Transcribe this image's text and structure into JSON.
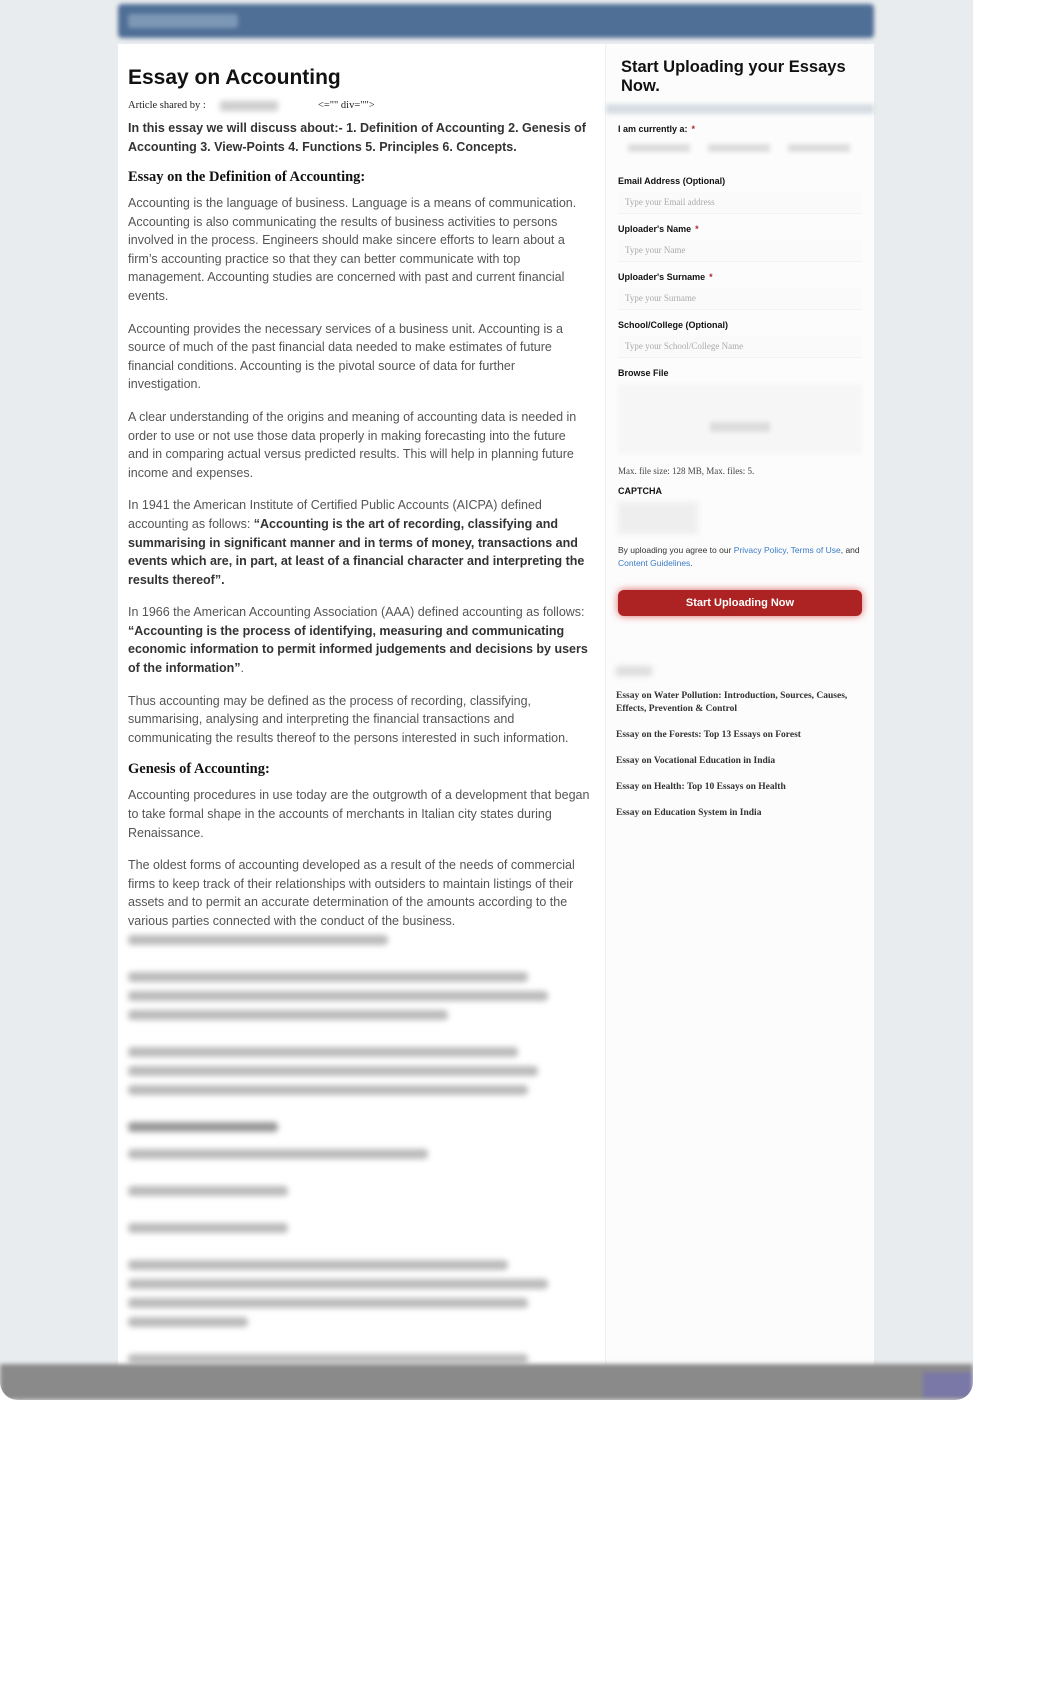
{
  "article": {
    "title": "Essay on Accounting",
    "byline_label": "Article shared by :",
    "byline_artifact": "<=\"\" div=\"\">",
    "intro": "In this essay we will discuss about:- 1. Definition of Accounting 2. Genesis of Accounting 3. View-Points 4. Functions 5. Principles 6. Concepts.",
    "section1_heading": "Essay on the Definition of Accounting:",
    "p1": "Accounting is the language of business. Language is a means of communication. Accounting is also communicating the results of business activities to persons involved in the process. Engineers should make sincere efforts to learn about a firm’s accounting practice so that they can better communicate with top management. Accounting studies are concerned with past and current financial events.",
    "p2": "Accounting provides the necessary services of a business unit. Accounting is a source of much of the past financial data needed to make estimates of future financial conditions. Accounting is the pivotal source of data for further investigation.",
    "p3": "A clear understanding of the origins and meaning of accounting data is needed in order to use or not use those data properly in making forecasting into the future and in comparing actual versus predicted results. This will help in planning future income and expenses.",
    "p4_lead": "In 1941 the American Institute of Certified Public Accounts (AICPA) defined accounting as follows: ",
    "p4_quote": "“Accounting is the art of recording, classifying and summarising in significant manner and in terms of money, transactions and events which are, in part, at least of a financial character and interpreting the results thereof”.",
    "p5_lead": "In 1966 the American Accounting Association (AAA) defined accounting as follows: ",
    "p5_quote": "“Accounting is the process of identifying, measuring and communicating economic information to permit informed judgements and decisions by users of the information”",
    "p5_tail": ".",
    "p6": "Thus accounting may be defined as the process of recording, classifying, summarising, analysing and interpreting the financial transactions and communicating the results thereof to the persons interested in such information.",
    "section2_heading": "Genesis of Accounting:",
    "p7": "Accounting procedures in use today are the outgrowth of a development that began to take formal shape in the accounts of merchants in Italian city states during Renaissance.",
    "p8": "The oldest forms of accounting developed as a result of the needs of commercial firms to keep track of their relationships with outsiders to maintain listings of their assets and to permit an accurate determination of the amounts according to the various parties connected with the conduct of the business."
  },
  "sidebar": {
    "title": "Start Uploading your Essays Now.",
    "currently_label": "I am currently a:",
    "required_mark": "*",
    "email_label": "Email Address (Optional)",
    "email_placeholder": "Type your Email address",
    "name_label": "Uploader's Name",
    "name_placeholder": "Type your Name",
    "surname_label": "Uploader's Surname",
    "surname_placeholder": "Type your Surname",
    "school_label": "School/College (Optional)",
    "school_placeholder": "Type your School/College Name",
    "browse_label": "Browse File",
    "file_limits": "Max. file size: 128 MB, Max. files: 5.",
    "captcha_label": "CAPTCHA",
    "agree_prefix": "By uploading you agree to our ",
    "privacy": "Privacy Policy",
    "terms": "Terms of Use",
    "and": ", and",
    "guidelines": "Content Guidelines",
    "submit": "Start Uploading Now",
    "related": [
      "Essay on Water Pollution: Introduction, Sources, Causes, Effects, Prevention & Control",
      "Essay on the Forests: Top 13 Essays on Forest",
      "Essay on Vocational Education in India",
      "Essay on Health: Top 10 Essays on Health",
      "Essay on Education System in India"
    ]
  },
  "colors": {
    "header": "#4f6f96",
    "button": "#ad2222",
    "link": "#3a7bc8"
  }
}
